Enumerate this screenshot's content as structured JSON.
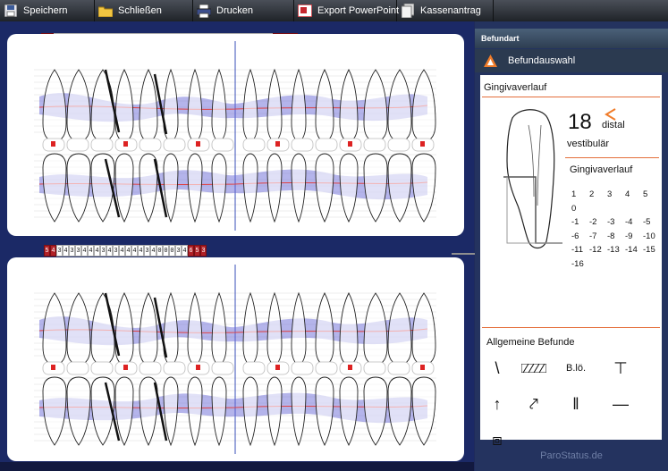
{
  "toolbar": {
    "buttons": [
      {
        "label": "Speichern",
        "icon": "floppy-icon"
      },
      {
        "label": "Schließen",
        "icon": "folder-icon"
      },
      {
        "label": "Drucken",
        "icon": "printer-icon"
      },
      {
        "label": "Export PowerPoint",
        "icon": "powerpoint-icon"
      },
      {
        "label": "Kassenantrag",
        "icon": "document-stack-icon"
      }
    ]
  },
  "chart": {
    "upper_top_codes": "5 4 3 4 0 0 0 3 3 3 0 0 0 3 3 3 2 3 3 3 2 3 3 3 3 3 3 3 0 0 0 0 0 0 3 4 5 4 5 5 4",
    "upper_bottom_codes": "7 5 7 3 4 0 0 0 3 3 3 0 0 0 0 3 3 3 3 3 3 3 3 3 3 3 3 3 0 0 0 3 3 4 3 4 5 4 3 5 6 3 5",
    "lower_top_codes": "5 4 3 4 3 3 4 4 4 3 4 3 4 4 4 4 3 4 0 0 0 3 4 6 5 3",
    "lower_bottom_codes": "5 3 4 4 3 4 4 3 4 3 4 3 4 4 3 4 4 3 4 4 5 4",
    "accent_red": "#b02027",
    "gum_blue": "#6a6ad8"
  },
  "side": {
    "header": "Befundart",
    "subheader": "Befundauswahl",
    "card_title": "Gingivaverlauf",
    "tooth_number": "18",
    "surface": "distal",
    "side_label": "vestibulär",
    "gv_title": "Gingivaverlauf",
    "gv_values": [
      "1",
      "2",
      "3",
      "4",
      "5",
      "0",
      "-1",
      "-2",
      "-3",
      "-4",
      "-5",
      "-6",
      "-7",
      "-8",
      "-9",
      "-10",
      "-11",
      "-12",
      "-13",
      "-14",
      "-15",
      "-16"
    ],
    "general_title": "Allgemeine Befunde",
    "general_icons": [
      {
        "name": "slash-line-icon",
        "glyph": "\\"
      },
      {
        "name": "hatched-bar-icon",
        "glyph": ""
      },
      {
        "name": "bloe-label",
        "glyph": "B.lö."
      },
      {
        "name": "implant-icon",
        "glyph": "⊤"
      },
      {
        "name": "arrow-up-icon",
        "glyph": "↑"
      },
      {
        "name": "crossed-arrow-icon",
        "glyph": "⤤"
      },
      {
        "name": "double-bar-icon",
        "glyph": "‖"
      },
      {
        "name": "horizontal-line-icon",
        "glyph": "—"
      },
      {
        "name": "bridge-box-icon",
        "glyph": "⧈"
      }
    ],
    "footer": "ParoStatus.de"
  }
}
